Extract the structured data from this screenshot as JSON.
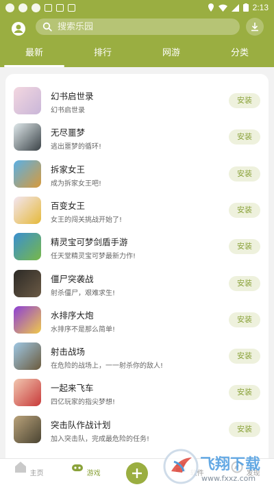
{
  "statusbar": {
    "time": "2:13"
  },
  "search": {
    "placeholder": "搜索乐园"
  },
  "tabs": [
    {
      "label": "最新",
      "active": true
    },
    {
      "label": "排行",
      "active": false
    },
    {
      "label": "网游",
      "active": false
    },
    {
      "label": "分类",
      "active": false
    }
  ],
  "games": [
    {
      "title": "幻书启世录",
      "desc": "幻书启世录",
      "install": "安装",
      "icon": "anime-girl-icon",
      "c1": "#f3d7e0",
      "c2": "#c9b6d8"
    },
    {
      "title": "无尽噩梦",
      "desc": "逃出噩梦的循环!",
      "install": "安装",
      "icon": "dark-hand-icon",
      "c1": "#dfe8ea",
      "c2": "#3b4348"
    },
    {
      "title": "拆家女王",
      "desc": "成为拆家女王吧!",
      "install": "安装",
      "icon": "wrecking-queen-icon",
      "c1": "#5ab0e6",
      "c2": "#d89a3a"
    },
    {
      "title": "百变女王",
      "desc": "女王的闯关挑战开始了!",
      "install": "安装",
      "icon": "runner-girl-icon",
      "c1": "#f3e6f2",
      "c2": "#e5b93a"
    },
    {
      "title": "精灵宝可梦剑盾手游",
      "desc": "任天堂精灵宝可梦最新力作!",
      "install": "安装",
      "icon": "pokemon-icon",
      "c1": "#3a8fd1",
      "c2": "#77b848"
    },
    {
      "title": "僵尸突袭战",
      "desc": "射杀僵尸，艰难求生!",
      "install": "安装",
      "icon": "zombie-soldier-icon",
      "c1": "#2c2a26",
      "c2": "#6b5a45"
    },
    {
      "title": "水排序大炮",
      "desc": "水排序不是那么简单!",
      "install": "安装",
      "icon": "color-tubes-icon",
      "c1": "#8c3fd6",
      "c2": "#f0c94a"
    },
    {
      "title": "射击战场",
      "desc": "在危险的战场上，一一射杀你的敌人!",
      "install": "安装",
      "icon": "battlefield-icon",
      "c1": "#9ec7e4",
      "c2": "#6b5a3c"
    },
    {
      "title": "一起来飞车",
      "desc": "四亿玩家的指尖梦想!",
      "install": "安装",
      "icon": "racing-girl-icon",
      "c1": "#f1c7b0",
      "c2": "#c83a3a"
    },
    {
      "title": "突击队作战计划",
      "desc": "加入突击队，完成最危险的任务!",
      "install": "安装",
      "icon": "commando-icon",
      "c1": "#b9a27a",
      "c2": "#4a4432"
    }
  ],
  "bottomnav": {
    "home": "主页",
    "games": "游戏",
    "mid_right": "软件",
    "right": "发现"
  },
  "watermark": {
    "brand": "飞翔下载",
    "url": "www.fxxz.com"
  },
  "colors": {
    "accent": "#9aae41",
    "install_bg": "#eef1dd",
    "install_text": "#8aa23a"
  }
}
